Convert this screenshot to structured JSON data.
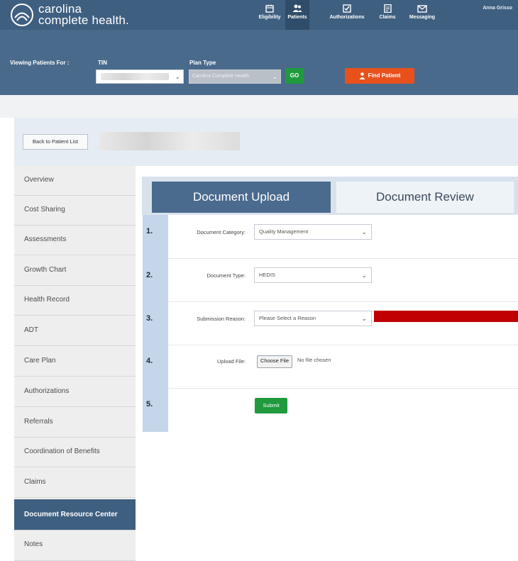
{
  "header": {
    "logo_line1": "carolina",
    "logo_line2": "complete health.",
    "user_name": "Anna Grisso",
    "nav": [
      {
        "label": "Eligibility",
        "icon": "calendar-icon"
      },
      {
        "label": "Patients",
        "icon": "patients-icon"
      },
      {
        "label": "Authorizations",
        "icon": "authorizations-icon"
      },
      {
        "label": "Claims",
        "icon": "claims-icon"
      },
      {
        "label": "Messaging",
        "icon": "envelope-icon"
      }
    ]
  },
  "filter": {
    "viewing_label": "Viewing Patients For :",
    "tin_label": "TIN",
    "plan_type_label": "Plan Type",
    "plan_type_value": "Carolina Complete Health",
    "go_label": "GO",
    "find_patient_label": "Find Patient"
  },
  "back_button_label": "Back to Patient List",
  "sidebar": {
    "items": [
      "Overview",
      "Cost Sharing",
      "Assessments",
      "Growth Chart",
      "Health Record",
      "ADT",
      "Care Plan",
      "Authorizations",
      "Referrals",
      "Coordination of Benefits",
      "Claims",
      "Document Resource Center",
      "Notes"
    ],
    "active": "Document Resource Center"
  },
  "tabs": {
    "upload": "Document Upload",
    "review": "Document Review"
  },
  "form": {
    "steps": [
      "1.",
      "2.",
      "3.",
      "4.",
      "5."
    ],
    "category_label": "Document Category:",
    "category_value": "Quality Management",
    "type_label": "Document Type:",
    "type_value": "HEDIS",
    "reason_label": "Submission Reason:",
    "reason_value": "Please Select a Reason",
    "upload_label": "Upload File:",
    "choose_file_label": "Choose File",
    "no_file_text": "No file chosen",
    "submit_label": "Submit"
  },
  "colors": {
    "header": "#3f5f80",
    "filterbar": "#4a6a8c",
    "go_button": "#1f9a3d",
    "find_button": "#e8501c",
    "highlight_bar": "#c00000"
  }
}
